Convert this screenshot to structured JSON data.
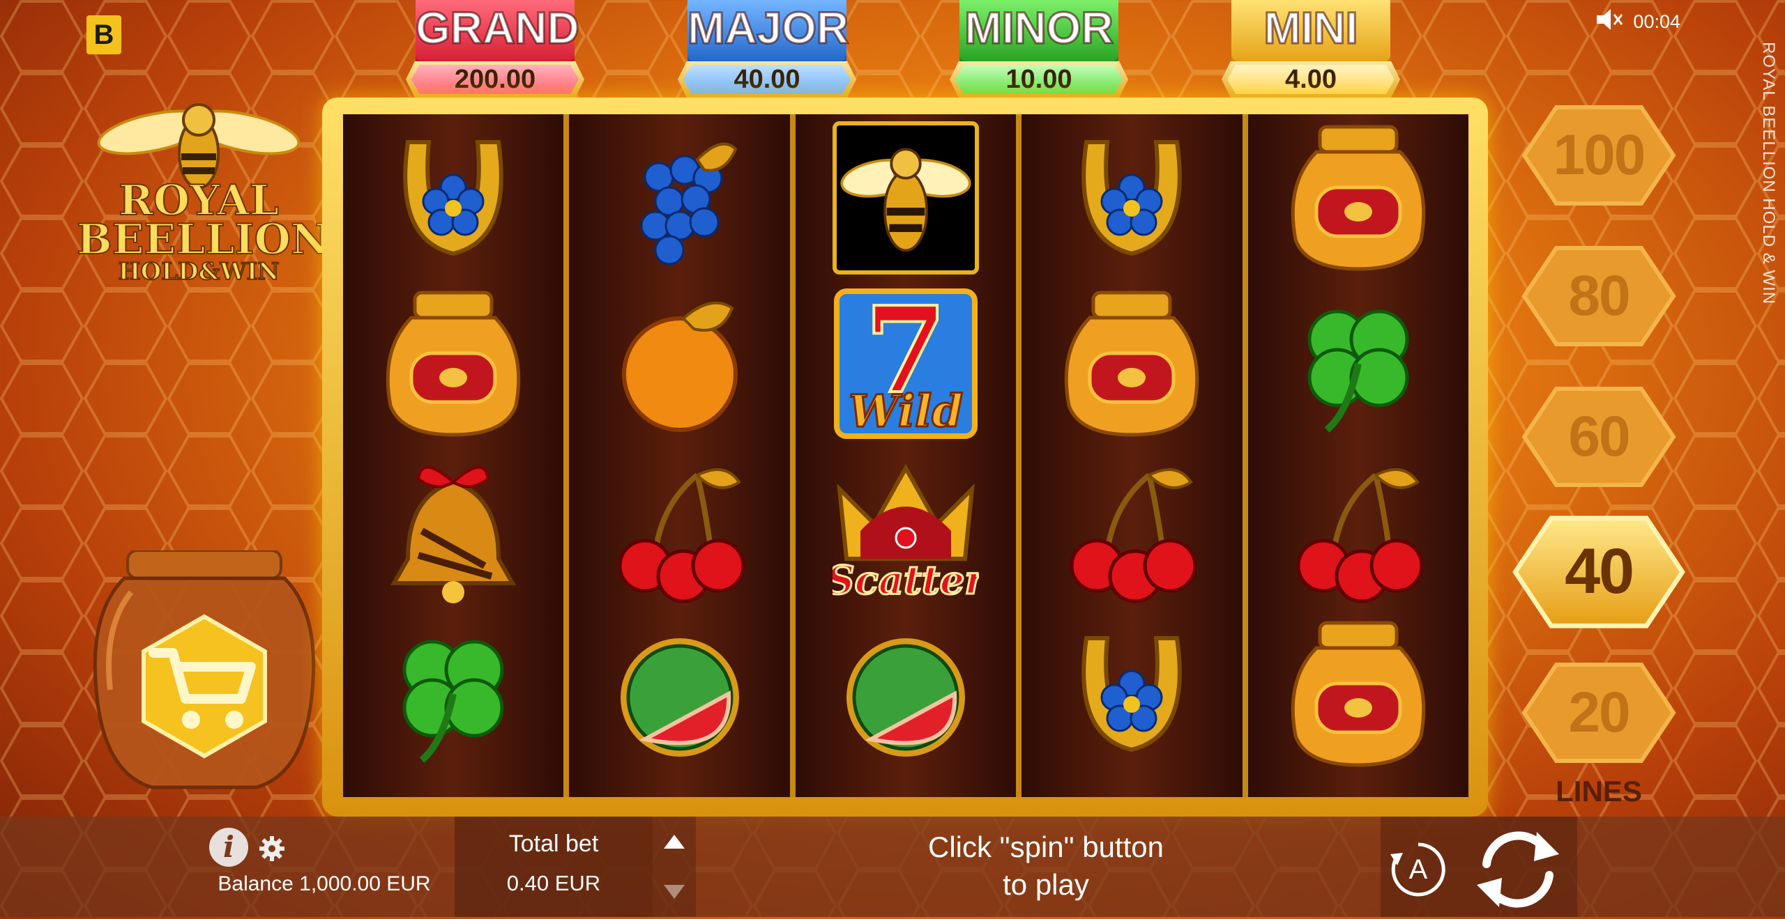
{
  "brand": {
    "letter": "B"
  },
  "status": {
    "time": "00:04",
    "sound_icon": "mute-speaker-icon"
  },
  "game_title_vertical": "ROYAL BEELLION HOLD & WIN",
  "logo": {
    "line1": "ROYAL",
    "line2": "BEELLION",
    "line3": "HOLD&WIN"
  },
  "jackpots": [
    {
      "name": "GRAND",
      "value": "200.00",
      "color": "#e8233a"
    },
    {
      "name": "MAJOR",
      "value": "40.00",
      "color": "#2b7fe0"
    },
    {
      "name": "MINOR",
      "value": "10.00",
      "color": "#2fb82b"
    },
    {
      "name": "MINI",
      "value": "4.00",
      "color": "#f2b11c"
    }
  ],
  "reels": [
    [
      "horseshoe",
      "honey-jar",
      "bell",
      "clover"
    ],
    [
      "grapes",
      "orange",
      "cherries",
      "watermelon"
    ],
    [
      "bee",
      "wild-seven",
      "scatter-crown",
      "watermelon"
    ],
    [
      "horseshoe",
      "honey-jar",
      "cherries",
      "horseshoe"
    ],
    [
      "honey-jar",
      "clover",
      "cherries",
      "honey-jar"
    ]
  ],
  "symbol_text": {
    "wild": "Wild",
    "scatter": "Scatter",
    "seven": "7"
  },
  "lines": {
    "options": [
      "100",
      "80",
      "60",
      "40",
      "20"
    ],
    "selected": "40",
    "label": "LINES"
  },
  "bottom": {
    "balance": "Balance 1,000.00 EUR",
    "total_bet_label": "Total bet",
    "total_bet_value": "0.40 EUR",
    "message_line1": "Click \"spin\" button",
    "message_line2": "to play",
    "autoplay_letter": "A"
  }
}
